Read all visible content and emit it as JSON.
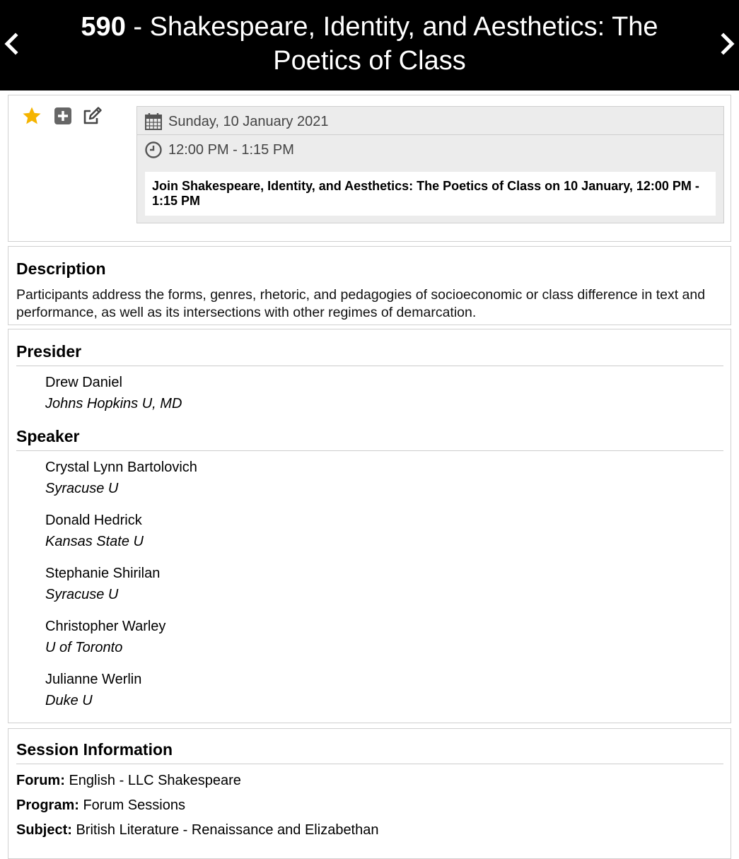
{
  "header": {
    "number": "590",
    "separator": " - ",
    "title": "Shakespeare, Identity, and Aesthetics: The Poetics of Class",
    "prev_icon": "chevron-left-icon",
    "next_icon": "chevron-right-icon"
  },
  "actions": [
    {
      "icon": "star-icon",
      "color": "#f5b400"
    },
    {
      "icon": "plus-square-icon",
      "color": "#666666"
    },
    {
      "icon": "edit-icon",
      "color": "#444444"
    }
  ],
  "schedule": {
    "date": "Sunday, 10 January 2021",
    "date_icon": "calendar-icon",
    "time": "12:00 PM - 1:15 PM",
    "time_icon": "clock-icon",
    "join_text": "Join Shakespeare, Identity, and Aesthetics: The Poetics of Class on 10 January, 12:00 PM - 1:15 PM"
  },
  "description": {
    "heading": "Description",
    "text": "Participants address the forms, genres, rhetoric, and pedagogies of socioeconomic or class difference in text and performance, as well as its intersections with other regimes of demarcation."
  },
  "presider": {
    "heading": "Presider",
    "people": [
      {
        "name": "Drew Daniel",
        "affiliation": "Johns Hopkins U, MD"
      }
    ]
  },
  "speaker": {
    "heading": "Speaker",
    "people": [
      {
        "name": "Crystal Lynn Bartolovich",
        "affiliation": "Syracuse U"
      },
      {
        "name": "Donald Hedrick",
        "affiliation": "Kansas State U"
      },
      {
        "name": "Stephanie Shirilan",
        "affiliation": "Syracuse U"
      },
      {
        "name": "Christopher Warley",
        "affiliation": "U of Toronto"
      },
      {
        "name": "Julianne Werlin",
        "affiliation": "Duke U"
      }
    ]
  },
  "session_info": {
    "heading": "Session Information",
    "forum_label": "Forum:",
    "forum_value": "English - LLC Shakespeare",
    "program_label": "Program:",
    "program_value": "Forum Sessions",
    "subject_label": "Subject:",
    "subject_value": "British Literature - Renaissance and Elizabethan"
  }
}
